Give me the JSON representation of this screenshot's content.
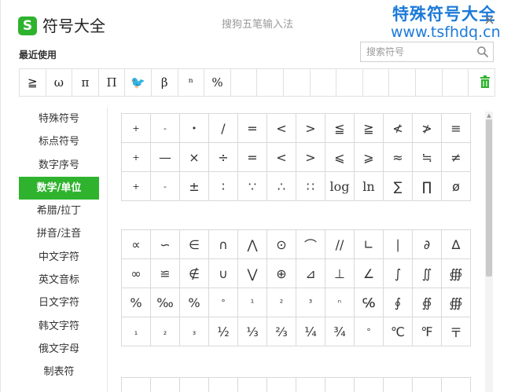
{
  "window": {
    "title": "符号大全",
    "ime_name": "搜狗五笔输入法",
    "logo_letter": "S",
    "close_glyph": "×"
  },
  "watermark": {
    "line1": "特殊符号大全",
    "line2": "www.tsfhdq.cn"
  },
  "recent": {
    "label": "最近使用",
    "symbols": [
      "≧",
      "ω",
      "π",
      "Π",
      "🐦",
      "β",
      "ⁿ",
      "%",
      "",
      "",
      "",
      "",
      "",
      "",
      "",
      "",
      "",
      ""
    ]
  },
  "search": {
    "placeholder": "搜索符号",
    "value": ""
  },
  "sidebar": {
    "items": [
      {
        "label": "特殊符号",
        "active": false
      },
      {
        "label": "标点符号",
        "active": false
      },
      {
        "label": "数字序号",
        "active": false
      },
      {
        "label": "数学/单位",
        "active": true
      },
      {
        "label": "希腊/拉丁",
        "active": false
      },
      {
        "label": "拼音/注音",
        "active": false
      },
      {
        "label": "中文字符",
        "active": false
      },
      {
        "label": "英文音标",
        "active": false
      },
      {
        "label": "日文字符",
        "active": false
      },
      {
        "label": "韩文字符",
        "active": false
      },
      {
        "label": "俄文字母",
        "active": false
      },
      {
        "label": "制表符",
        "active": false
      }
    ]
  },
  "grid1": [
    [
      "+",
      "-",
      "•",
      "/",
      "=",
      "<",
      ">",
      "≦",
      "≧",
      "≮",
      "≯",
      "≡"
    ],
    [
      "+",
      "—",
      "×",
      "÷",
      "=",
      "<",
      ">",
      "⩽",
      "⩾",
      "≈",
      "≒",
      "≠"
    ],
    [
      "+",
      "-",
      "±",
      "∶",
      "∵",
      "∴",
      "∷",
      "log",
      "ln",
      "∑",
      "∏",
      "ø"
    ]
  ],
  "grid2": [
    [
      "∝",
      "∽",
      "∈",
      "∩",
      "⋀",
      "⊙",
      "⌒",
      "//",
      "∟",
      "∣",
      "∂",
      "∆"
    ],
    [
      "∞",
      "≌",
      "∉",
      "∪",
      "⋁",
      "⊕",
      "⊿",
      "⊥",
      "∠",
      "∫",
      "∬",
      "∰"
    ],
    [
      "%",
      "‰",
      "%",
      "°",
      "¹",
      "²",
      "³",
      "ⁿ",
      "℅",
      "∮",
      "∯",
      "∰"
    ],
    [
      "₁",
      "₂",
      "₃",
      "½",
      "⅓",
      "⅔",
      "¼",
      "¾",
      "°",
      "℃",
      "℉",
      "〒"
    ]
  ]
}
